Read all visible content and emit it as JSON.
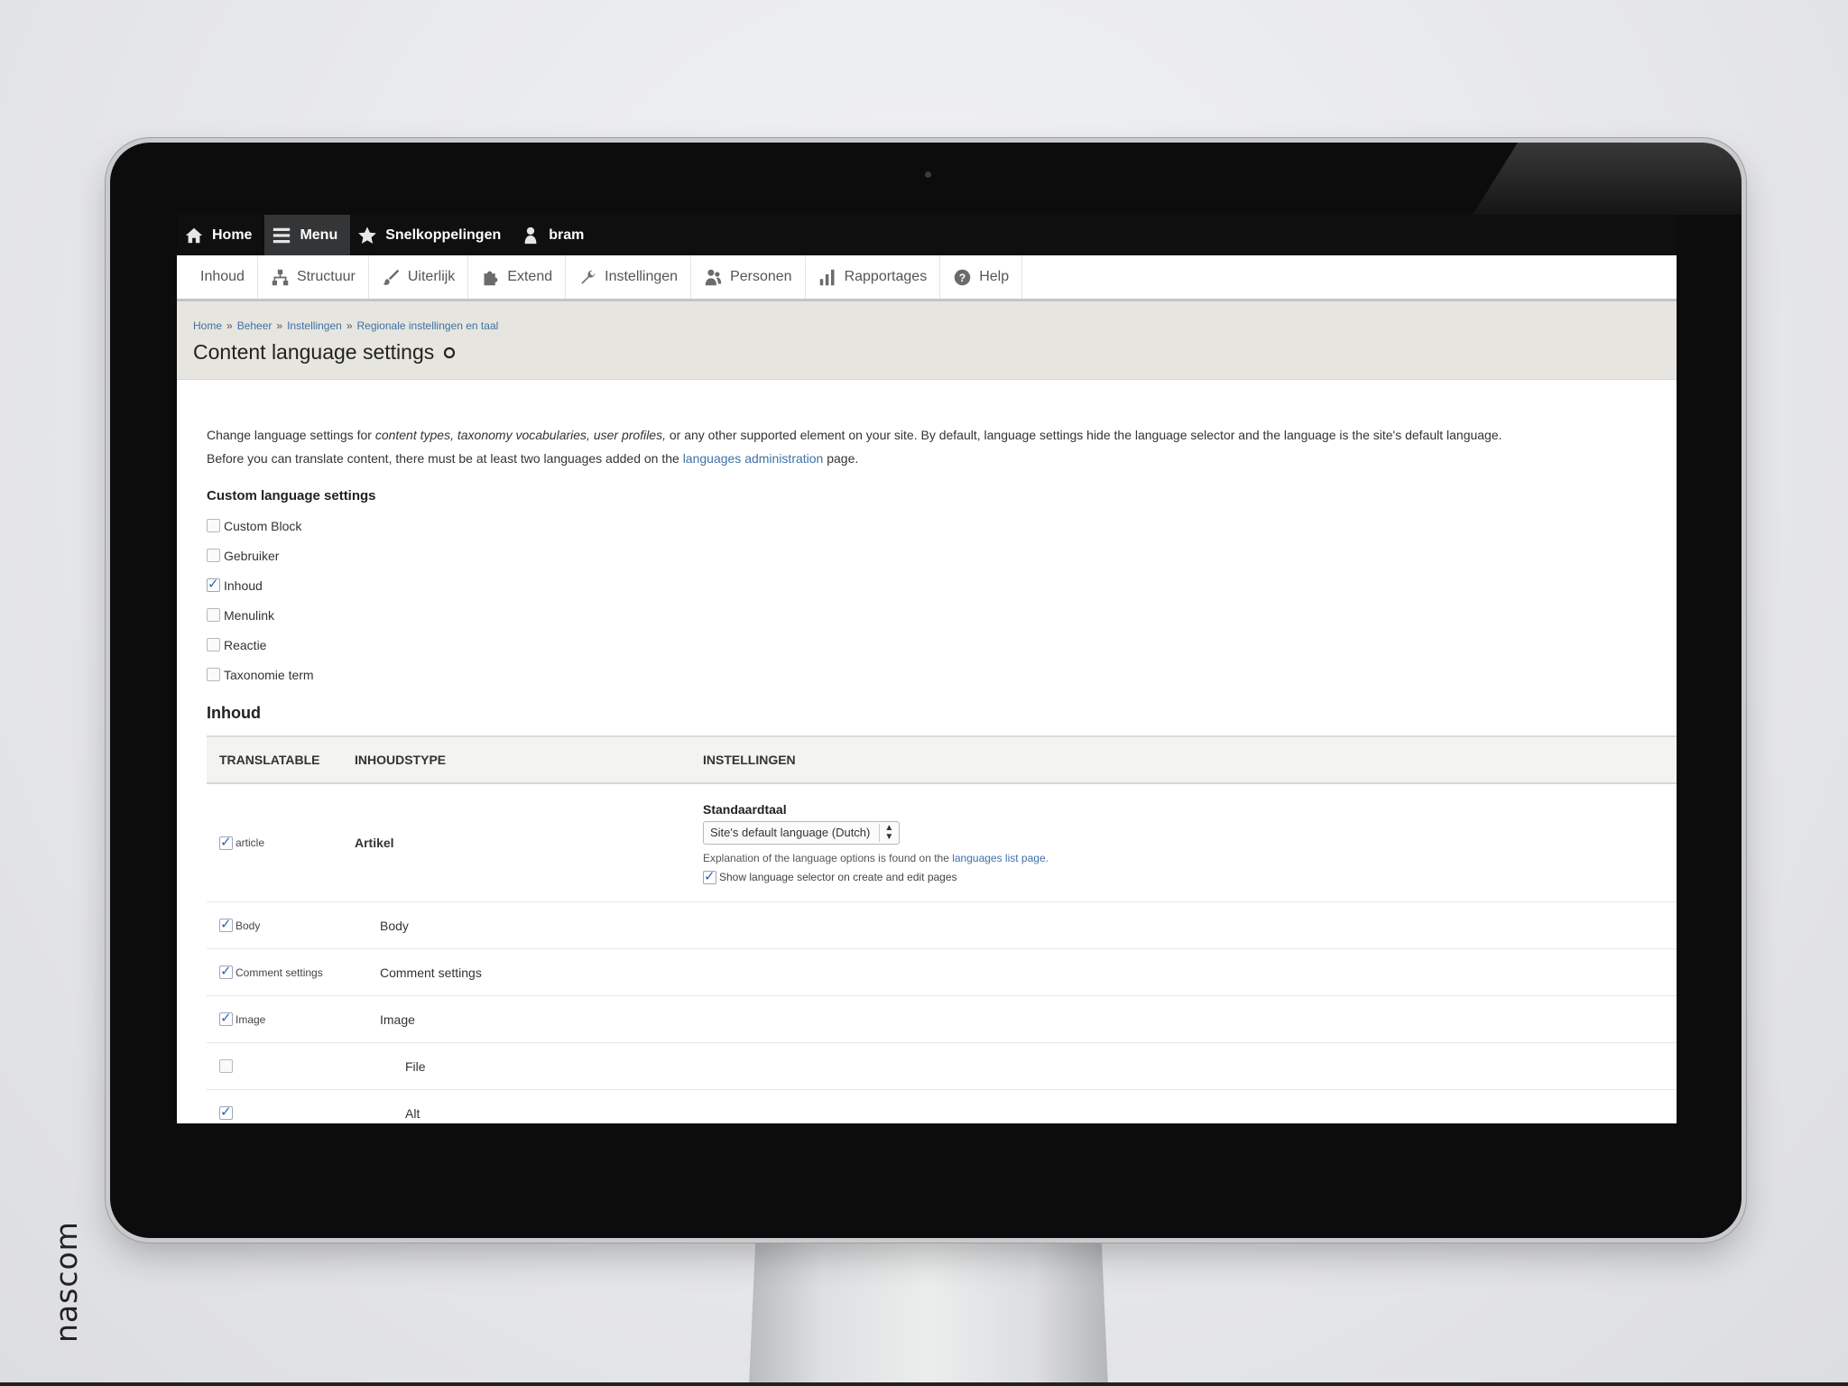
{
  "toolbar": {
    "home": "Home",
    "menu": "Menu",
    "shortcuts": "Snelkoppelingen",
    "user": "bram"
  },
  "tray": [
    {
      "label": "Inhoud",
      "icon": ""
    },
    {
      "label": "Structuur",
      "icon": "sitemap-icon"
    },
    {
      "label": "Uiterlijk",
      "icon": "brush-icon"
    },
    {
      "label": "Extend",
      "icon": "puzzle-icon"
    },
    {
      "label": "Instellingen",
      "icon": "wrench-icon"
    },
    {
      "label": "Personen",
      "icon": "people-icon"
    },
    {
      "label": "Rapportages",
      "icon": "barchart-icon"
    },
    {
      "label": "Help",
      "icon": "help-icon"
    }
  ],
  "breadcrumb": [
    "Home",
    "Beheer",
    "Instellingen",
    "Regionale instellingen en taal"
  ],
  "breadcrumb_sep": "»",
  "page_title": "Content language settings",
  "description": {
    "part1": "Change language settings for ",
    "em1": "content types, taxonomy vocabularies, user profiles,",
    "part2": " or any other supported element on your site. By default, language settings hide the language selector and the language is the site's default language.",
    "part3": "Before you can translate content, there must be at least two languages added on the ",
    "link": "languages administration",
    "part4": " page."
  },
  "custom_settings": {
    "title": "Custom language settings",
    "items": [
      {
        "label": "Custom Block",
        "checked": false
      },
      {
        "label": "Gebruiker",
        "checked": false
      },
      {
        "label": "Inhoud",
        "checked": true
      },
      {
        "label": "Menulink",
        "checked": false
      },
      {
        "label": "Reactie",
        "checked": false
      },
      {
        "label": "Taxonomie term",
        "checked": false
      }
    ]
  },
  "section_title": "Inhoud",
  "table": {
    "headers": [
      "TRANSLATABLE",
      "INHOUDSTYPE",
      "INSTELLINGEN"
    ],
    "main_row": {
      "translatable": "article",
      "type": "Artikel",
      "settings_label": "Standaardtaal",
      "select_value": "Site's default language (Dutch)",
      "help_part": "Explanation of the language options is found on the ",
      "help_link": "languages list page.",
      "selector_label": "Show language selector on create and edit pages"
    },
    "rows": [
      {
        "translatable": "Body",
        "type": "Body",
        "checked": true
      },
      {
        "translatable": "Comment settings",
        "type": "Comment settings",
        "checked": true
      },
      {
        "translatable": "Image",
        "type": "Image",
        "checked": true
      },
      {
        "translatable": "",
        "type": "File",
        "checked": false
      },
      {
        "translatable": "",
        "type": "Alt",
        "checked": true
      }
    ]
  },
  "brand": "nascom"
}
